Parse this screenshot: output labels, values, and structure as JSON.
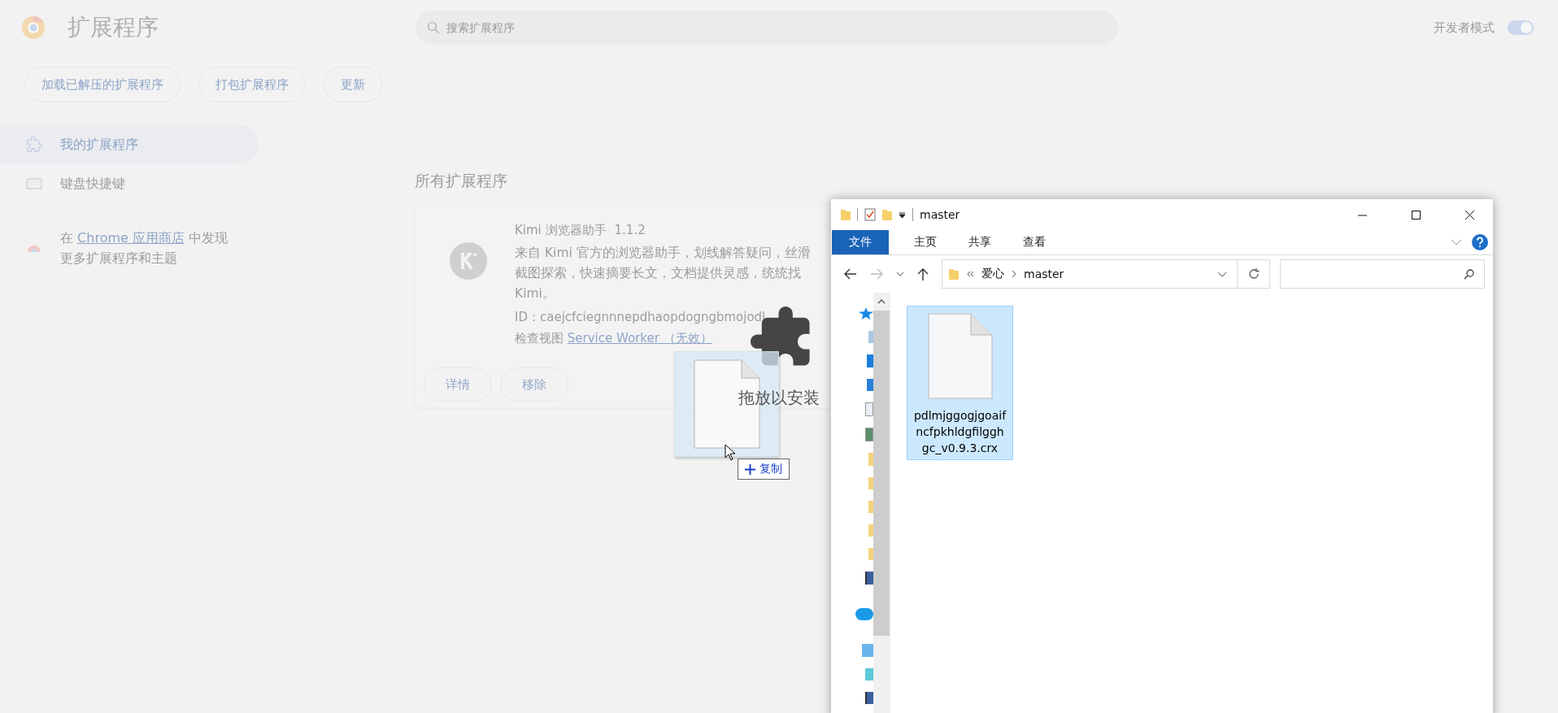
{
  "extensions_page": {
    "title": "扩展程序",
    "search": {
      "placeholder": "搜索扩展程序"
    },
    "developer_mode": {
      "label": "开发者模式",
      "on": true
    },
    "toolbar_buttons": [
      "加载已解压的扩展程序",
      "打包扩展程序",
      "更新"
    ],
    "sidebar": {
      "items": [
        {
          "label": "我的扩展程序",
          "selected": true,
          "kind": "extensions"
        },
        {
          "label": "键盘快捷键",
          "selected": false,
          "kind": "keyboard"
        }
      ],
      "discover": {
        "prefix": "在",
        "link": "Chrome 应用商店",
        "suffix": "中发现",
        "line2": "更多扩展程序和主题"
      }
    },
    "section_title": "所有扩展程序",
    "extension": {
      "name": "Kimi 浏览器助手",
      "version": "1.1.2",
      "description": "来自 Kimi 官方的浏览器助手，划线解答疑问，丝滑截图探索，快速摘要长文，文档提供灵感，统统找 Kimi。",
      "id": "ID：caejcfciegnnnepdhaopdogngbmojodl",
      "inspect_label": "检查视图",
      "inspect_link": "Service Worker （无效）",
      "buttons": [
        "详情",
        "移除"
      ]
    }
  },
  "drop_overlay": {
    "label": "拖放以安装"
  },
  "drag": {
    "effect": "复制"
  },
  "explorer": {
    "title": "master",
    "ribbon_tabs": [
      {
        "label": "文件",
        "selected": true
      },
      {
        "label": "主页",
        "selected": false
      },
      {
        "label": "共享",
        "selected": false
      },
      {
        "label": "查看",
        "selected": false
      }
    ],
    "breadcrumb": [
      "爱心",
      "master"
    ],
    "files": [
      {
        "name": "pdlmjggogjgoaifncfpkhldgfilgghgc_v0.9.3.crx",
        "selected": true
      }
    ]
  }
}
